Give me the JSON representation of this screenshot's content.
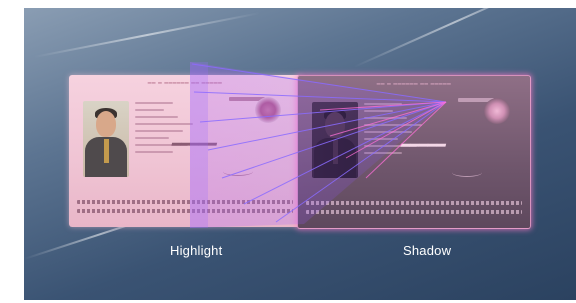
{
  "captions": {
    "highlight": "Highlight",
    "shadow": "Shadow"
  },
  "colors": {
    "background_dark": "#2b4260",
    "background_light": "#8a9db3",
    "highlight_card": "#efc3d3",
    "shadow_card": "#6f566c",
    "beam": "#7a4cff",
    "caption_text": "#ffffff"
  },
  "illustrations": [
    "passport-card-highlight",
    "passport-card-shadow",
    "light-beam-fan"
  ]
}
